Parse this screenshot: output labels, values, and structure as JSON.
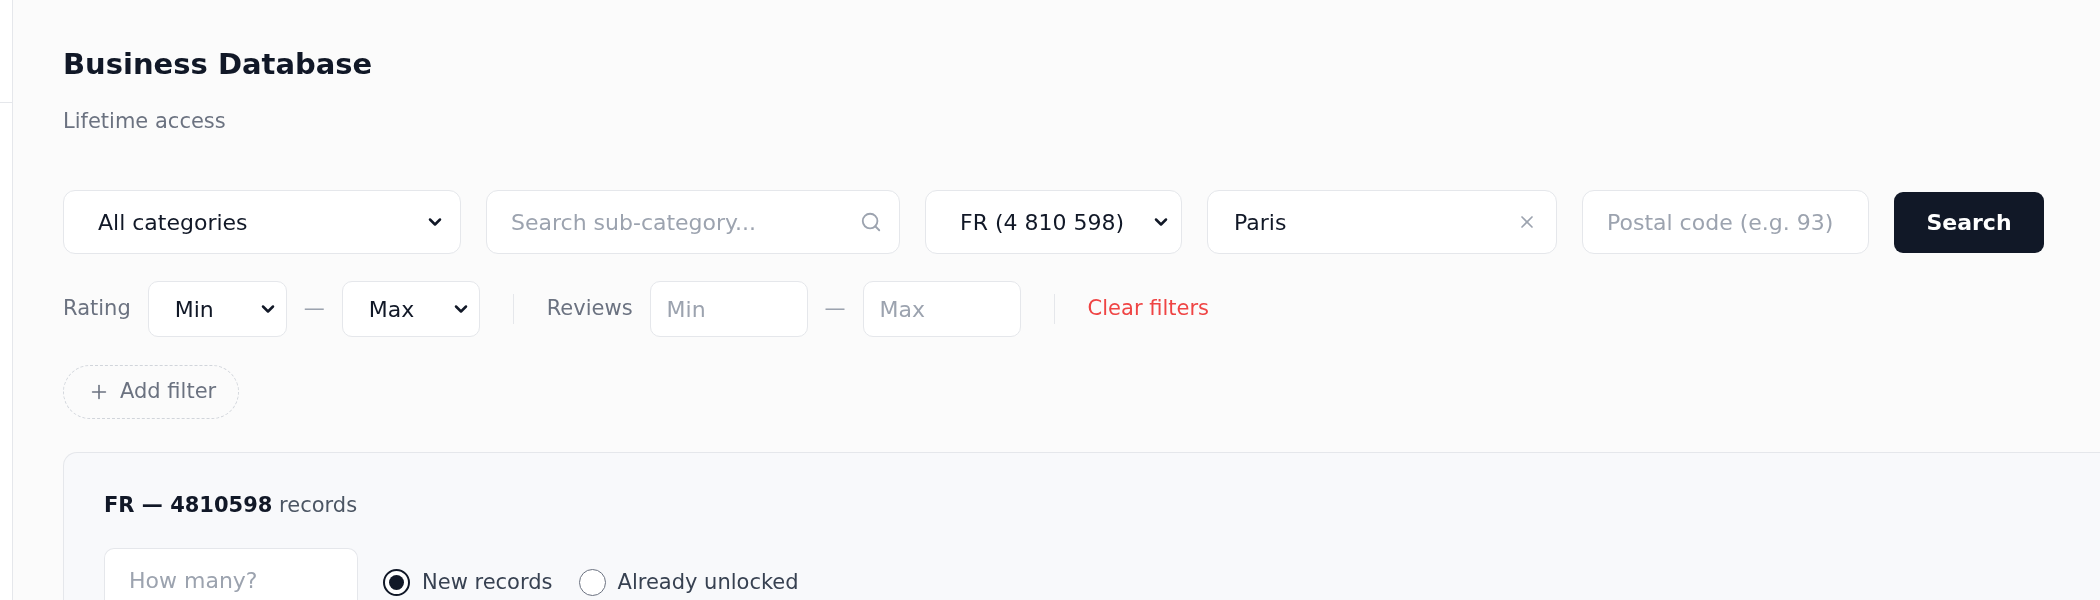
{
  "header": {
    "title": "Business Database",
    "subtitle": "Lifetime access"
  },
  "search_bar": {
    "category_select": {
      "value": "All categories"
    },
    "subcategory_field": {
      "placeholder": "Search sub-category..."
    },
    "country_select": {
      "value": "FR (4 810 598)"
    },
    "city_field": {
      "value": "Paris"
    },
    "postal_code_field": {
      "placeholder": "Postal code (e.g. 93)"
    },
    "search_button": "Search"
  },
  "filters": {
    "rating": {
      "label": "Rating",
      "min_select": {
        "value": "Min"
      },
      "separator": "—",
      "max_select": {
        "value": "Max"
      }
    },
    "reviews": {
      "label": "Reviews",
      "min_field": {
        "placeholder": "Min"
      },
      "separator": "—",
      "max_field": {
        "placeholder": "Max"
      }
    },
    "clear_filters": "Clear filters",
    "add_filter": "Add filter"
  },
  "records_panel": {
    "summary": "**FR — 4810598** records",
    "quantity_field": {
      "placeholder": "How many?"
    },
    "record_type": [
      {
        "label": "New records",
        "selected": true
      },
      {
        "label": "Already unlocked",
        "selected": false
      }
    ]
  }
}
